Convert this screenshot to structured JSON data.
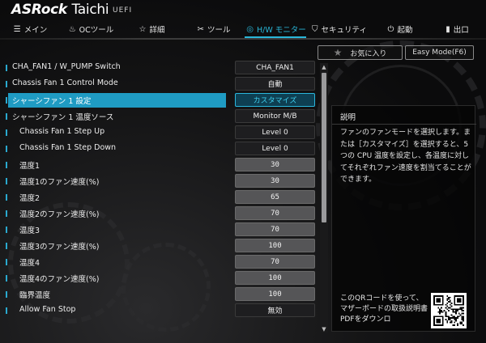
{
  "header": {
    "brand": "ASRock",
    "model": "Taichi",
    "uefi": "UEFI"
  },
  "nav": [
    {
      "label": "メイン",
      "icon": "list-icon",
      "glyph": "☰"
    },
    {
      "label": "OCツール",
      "icon": "flame-icon",
      "glyph": "♨"
    },
    {
      "label": "詳細",
      "icon": "star-icon",
      "glyph": "☆"
    },
    {
      "label": "ツール",
      "icon": "wrench-icon",
      "glyph": "✂"
    },
    {
      "label": "H/W モニター",
      "icon": "monitor-icon",
      "glyph": "◎",
      "active": true
    },
    {
      "label": "セキュリティ",
      "icon": "shield-icon",
      "glyph": "⛉"
    },
    {
      "label": "起動",
      "icon": "power-icon",
      "glyph": "⏻"
    },
    {
      "label": "出口",
      "icon": "exit-icon",
      "glyph": "▮"
    }
  ],
  "toolbar": {
    "favorites": "お気に入り",
    "easy_mode": "Easy Mode(F6)"
  },
  "settings": [
    {
      "label": "CHA_FAN1 / W_PUMP Switch",
      "value": "CHA_FAN1",
      "kind": "opt",
      "indent": 0
    },
    {
      "label": "Chassis Fan 1 Control Mode",
      "value": "自動",
      "kind": "opt",
      "indent": 0
    },
    {
      "label": "シャーシファン 1 設定",
      "value": "カスタマイズ",
      "kind": "selv",
      "indent": 0,
      "selected": true
    },
    {
      "label": "シャーシファン 1 温度ソース",
      "value": "Monitor M/B",
      "kind": "opt",
      "indent": 0
    },
    {
      "label": "Chassis Fan 1 Step Up",
      "value": "Level 0",
      "kind": "opt",
      "indent": 1
    },
    {
      "label": "Chassis Fan 1 Step Down",
      "value": "Level 0",
      "kind": "opt",
      "indent": 1
    },
    {
      "label": "温度1",
      "value": "30",
      "kind": "num",
      "indent": 1
    },
    {
      "label": "温度1のファン速度(%)",
      "value": "30",
      "kind": "num",
      "indent": 1
    },
    {
      "label": "温度2",
      "value": "65",
      "kind": "num",
      "indent": 1
    },
    {
      "label": "温度2のファン速度(%)",
      "value": "70",
      "kind": "num",
      "indent": 1
    },
    {
      "label": "温度3",
      "value": "70",
      "kind": "num",
      "indent": 1
    },
    {
      "label": "温度3のファン速度(%)",
      "value": "100",
      "kind": "num",
      "indent": 1
    },
    {
      "label": "温度4",
      "value": "70",
      "kind": "num",
      "indent": 1
    },
    {
      "label": "温度4のファン速度(%)",
      "value": "100",
      "kind": "num",
      "indent": 1
    },
    {
      "label": "臨界温度",
      "value": "100",
      "kind": "num",
      "indent": 1
    },
    {
      "label": "Allow Fan Stop",
      "value": "無効",
      "kind": "opt",
      "indent": 1
    }
  ],
  "help": {
    "title": "説明",
    "text": "ファンのファンモードを選択します。または［カスタマイズ］を選択すると、5 つの CPU 温度を設定し、各温度に対してそれぞれファン速度を割当てることができます。",
    "qr_text": "このQRコードを使って、マザーボードの取扱説明書PDFをダウンロ"
  },
  "colors": {
    "accent": "#29b6d8",
    "selection": "#1f9bc3"
  }
}
